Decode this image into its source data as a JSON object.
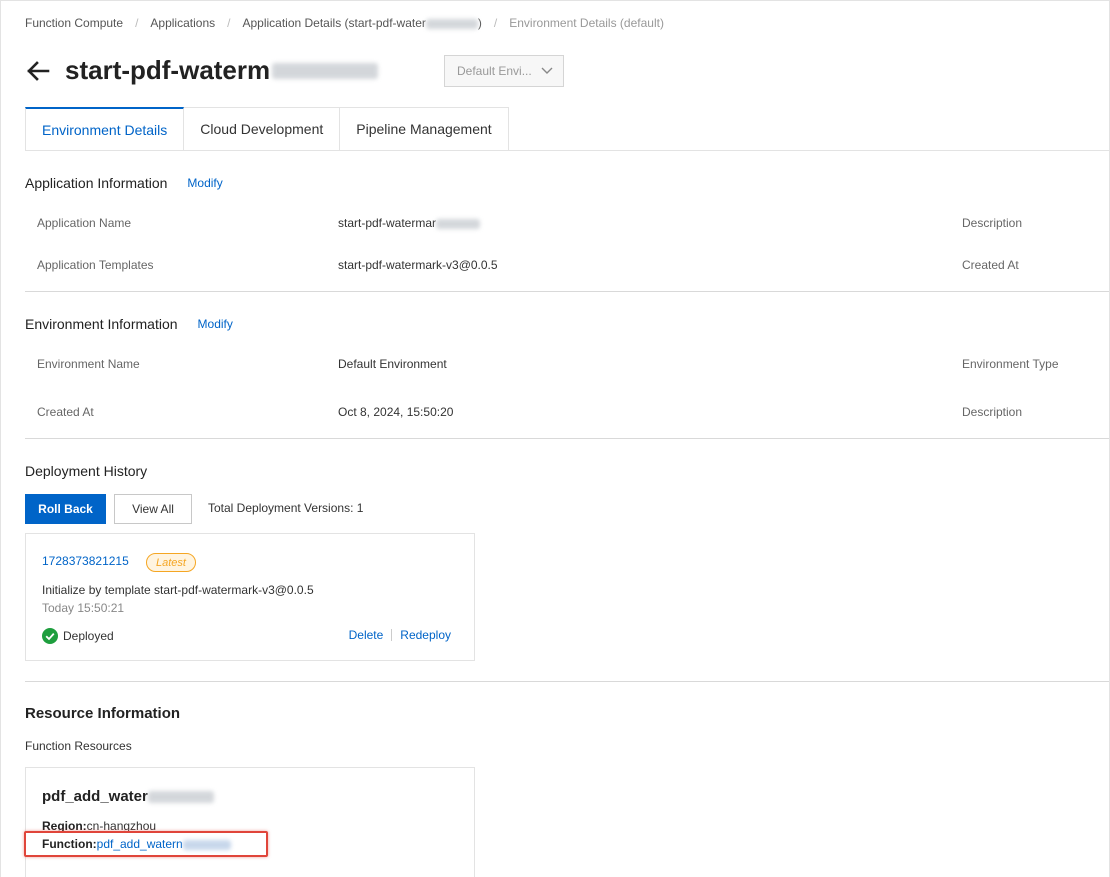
{
  "breadcrumb": {
    "items": [
      "Function Compute",
      "Applications",
      "Application Details (start-pdf-water",
      "Environment Details (default)"
    ],
    "app_details_suffix": ")"
  },
  "header": {
    "title": "start-pdf-waterm",
    "env_select_value": "Default Envi...",
    "colors": {
      "accent": "#0064c8"
    }
  },
  "tabs": [
    {
      "label": "Environment Details",
      "active": true
    },
    {
      "label": "Cloud Development",
      "active": false
    },
    {
      "label": "Pipeline Management",
      "active": false
    }
  ],
  "app_info": {
    "heading": "Application Information",
    "modify": "Modify",
    "rows": [
      {
        "label": "Application Name",
        "value": "start-pdf-watermar",
        "right_label": "Description"
      },
      {
        "label": "Application Templates",
        "value": "start-pdf-watermark-v3@0.0.5",
        "right_label": "Created At"
      }
    ]
  },
  "env_info": {
    "heading": "Environment Information",
    "modify": "Modify",
    "rows": [
      {
        "label": "Environment Name",
        "value": "Default Environment",
        "right_label": "Environment Type"
      },
      {
        "label": "Created At",
        "value": "Oct 8, 2024, 15:50:20",
        "right_label": "Description"
      }
    ]
  },
  "deployment": {
    "heading": "Deployment History",
    "roll_back": "Roll Back",
    "view_all": "View All",
    "total": "Total Deployment Versions: 1",
    "card": {
      "version": "1728373821215",
      "badge": "Latest",
      "description": "Initialize by template start-pdf-watermark-v3@0.0.5",
      "time": "Today 15:50:21",
      "status": "Deployed",
      "delete": "Delete",
      "redeploy": "Redeploy"
    }
  },
  "resources": {
    "heading": "Resource Information",
    "sub": "Function Resources",
    "card": {
      "name": "pdf_add_water",
      "region_label": "Region:",
      "region_value": "cn-hangzhou",
      "function_label": "Function:",
      "function_value": "pdf_add_watern"
    }
  }
}
